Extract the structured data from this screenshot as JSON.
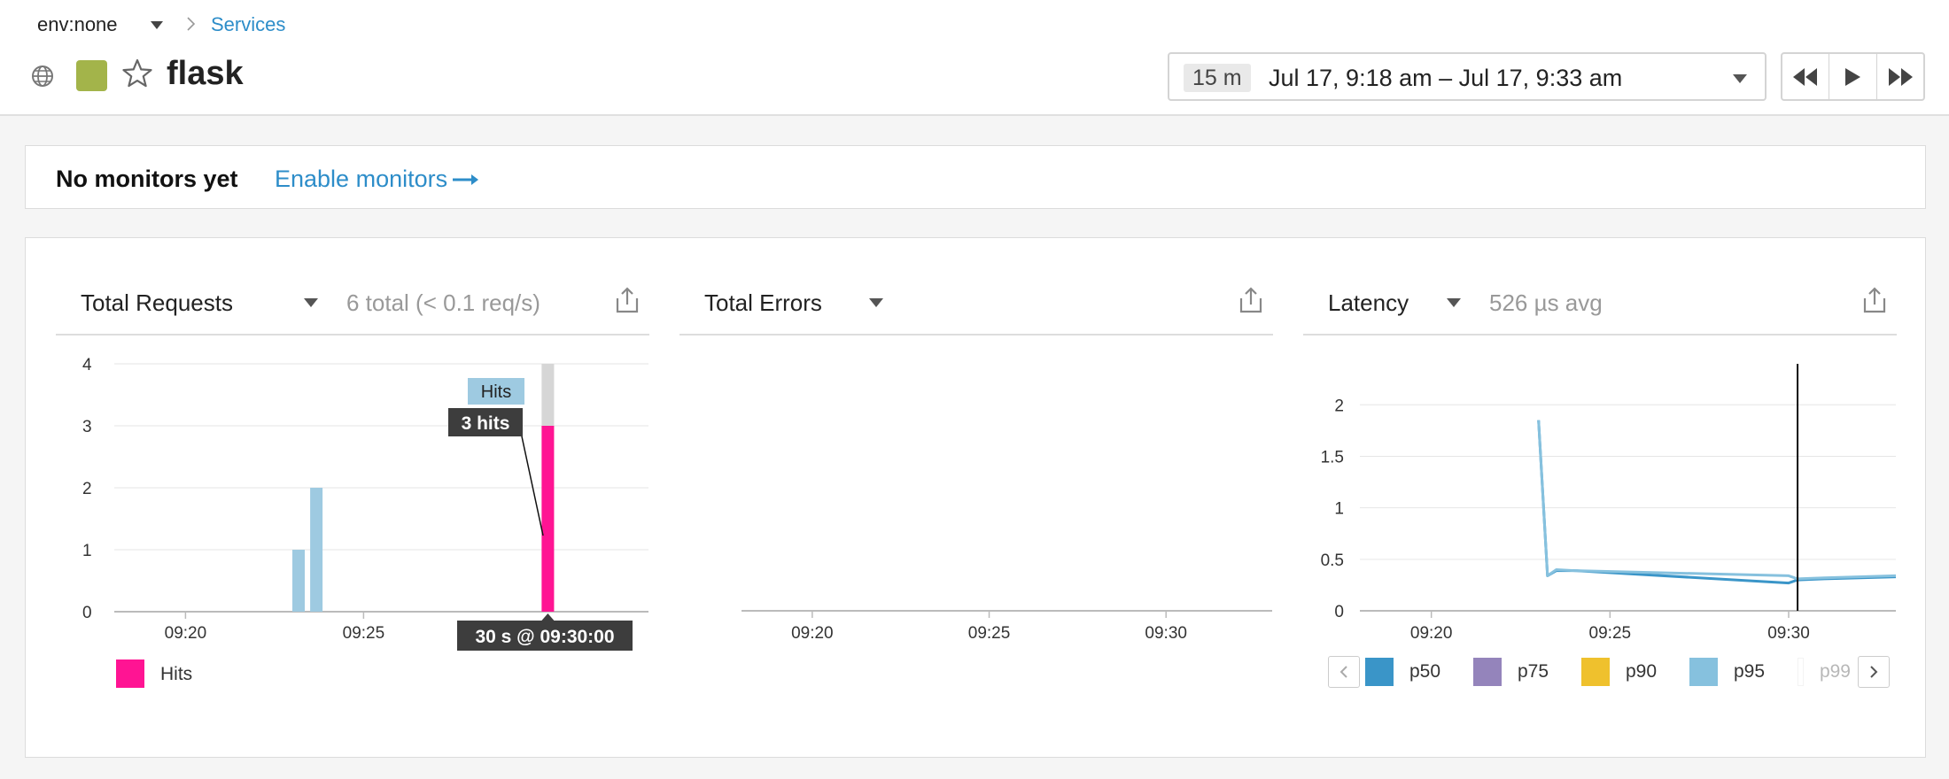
{
  "header": {
    "env_label": "env:none",
    "breadcrumb_services": "Services",
    "service_name": "flask",
    "status_color": "#a3b44a",
    "time_badge": "15 m",
    "time_range": "Jul 17, 9:18 am – Jul 17, 9:33 am"
  },
  "monitors": {
    "message": "No monitors yet",
    "enable_label": "Enable monitors"
  },
  "widgets": {
    "requests": {
      "title": "Total Requests",
      "summary": "6 total (< 0.1 req/s)",
      "legend": "Hits",
      "tooltip_series": "Hits",
      "tooltip_value": "3 hits",
      "tooltip_time": "30 s @ 09:30:00"
    },
    "errors": {
      "title": "Total Errors"
    },
    "latency": {
      "title": "Latency",
      "summary": "526 µs avg",
      "legend": [
        "p50",
        "p75",
        "p90",
        "p95",
        "p99"
      ]
    }
  },
  "colors": {
    "accent": "#2d8dc9",
    "hits": "#ff1493",
    "hits_light": "#9ecae1",
    "p50": "#3a95c8",
    "p75": "#9484bb",
    "p90": "#efc12d",
    "p95": "#86c1de"
  },
  "chart_data": [
    {
      "type": "bar",
      "title": "Total Requests",
      "x_ticks": [
        "09:20",
        "09:25"
      ],
      "ylim": [
        0,
        4
      ],
      "y_ticks": [
        "0",
        "1",
        "2",
        "3",
        "4"
      ],
      "series": [
        {
          "name": "Hits",
          "points": [
            {
              "time": "09:23:00",
              "value": 1,
              "color": "#9ecae1"
            },
            {
              "time": "09:23:30",
              "value": 2,
              "color": "#9ecae1"
            },
            {
              "time": "09:30:00",
              "value": 3,
              "color": "#ff1493"
            }
          ]
        }
      ],
      "highlight_band": {
        "time": "09:30:00",
        "value": 4
      }
    },
    {
      "type": "line",
      "title": "Total Errors",
      "x_ticks": [
        "09:20",
        "09:25",
        "09:30"
      ],
      "series": []
    },
    {
      "type": "line",
      "title": "Latency",
      "x_ticks": [
        "09:20",
        "09:25",
        "09:30"
      ],
      "ylim": [
        0,
        2.2
      ],
      "y_ticks": [
        "0",
        "0.5",
        "1",
        "1.5",
        "2"
      ],
      "cursor_time": "09:30:15",
      "series": [
        {
          "name": "p50",
          "points": [
            [
              "09:23:00",
              1.85
            ],
            [
              "09:23:15",
              0.34
            ],
            [
              "09:23:30",
              0.39
            ],
            [
              "09:24:00",
              0.39
            ],
            [
              "09:30:00",
              0.27
            ],
            [
              "09:30:15",
              0.3
            ],
            [
              "09:31:00",
              0.31
            ],
            [
              "09:33:00",
              0.33
            ]
          ]
        },
        {
          "name": "p95",
          "points": [
            [
              "09:23:00",
              1.85
            ],
            [
              "09:23:15",
              0.34
            ],
            [
              "09:23:30",
              0.4
            ],
            [
              "09:24:00",
              0.39
            ],
            [
              "09:30:00",
              0.34
            ],
            [
              "09:30:15",
              0.31
            ],
            [
              "09:31:00",
              0.32
            ],
            [
              "09:33:00",
              0.34
            ]
          ]
        }
      ]
    }
  ]
}
